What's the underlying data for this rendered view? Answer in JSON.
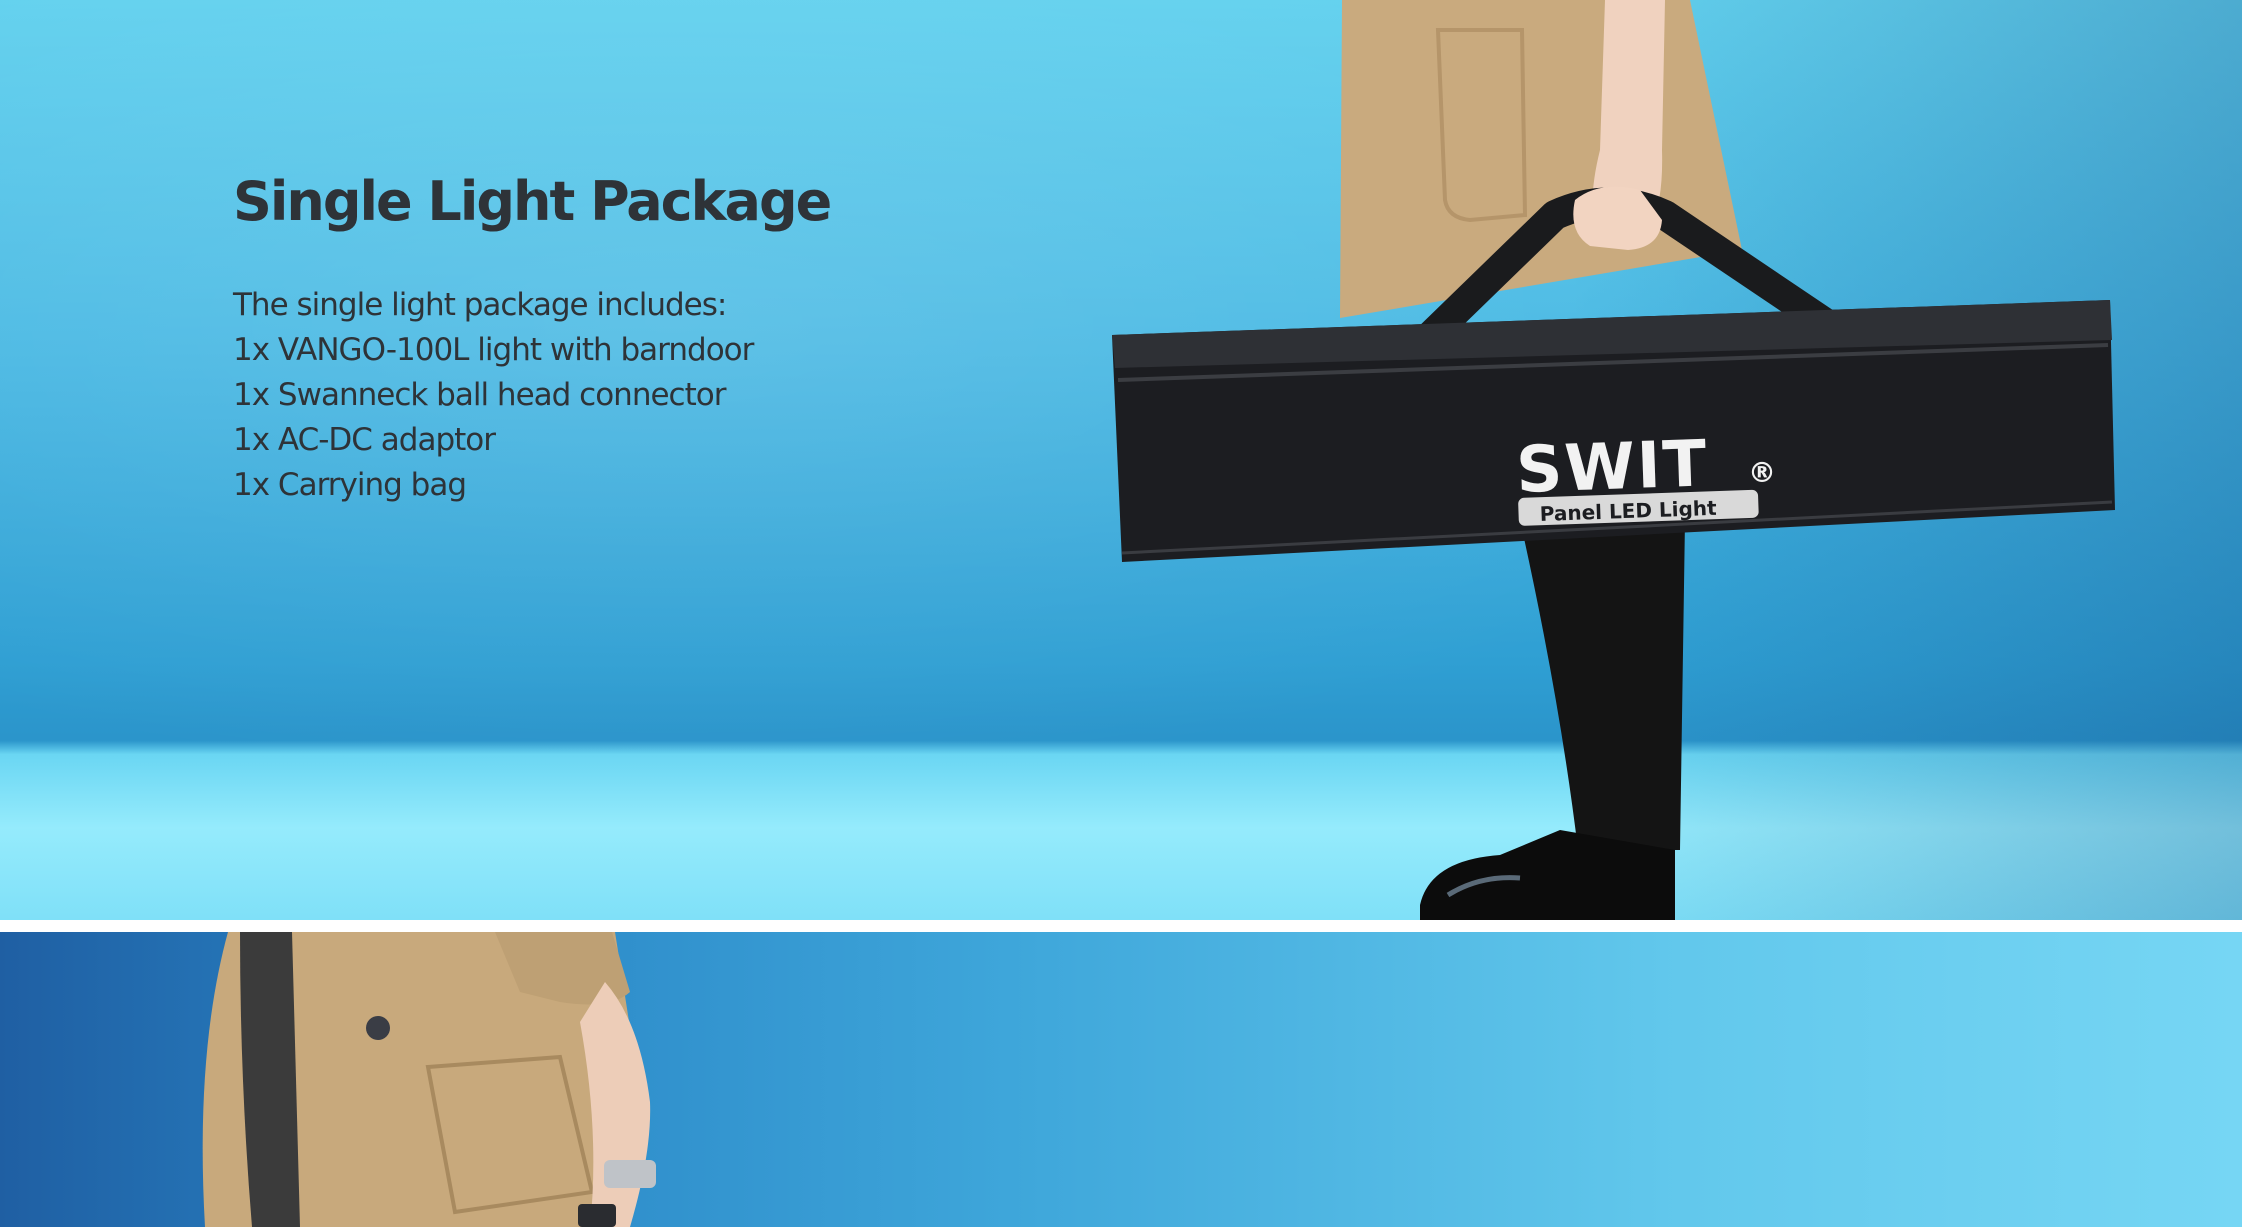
{
  "package": {
    "title": "Single Light Package",
    "intro": "The single light package includes:",
    "items": [
      "1x VANGO-100L light with barndoor",
      "1x Swanneck ball head connector",
      "1x AC-DC adaptor",
      "1x Carrying bag"
    ]
  },
  "bag": {
    "brand": "SWIT",
    "registered_mark": "®",
    "label": "Panel  LED  Light"
  },
  "colors": {
    "background": "#48b8e3",
    "text": "#2e3338",
    "coat": "#c8a97c",
    "bag": "#1c1d20"
  }
}
